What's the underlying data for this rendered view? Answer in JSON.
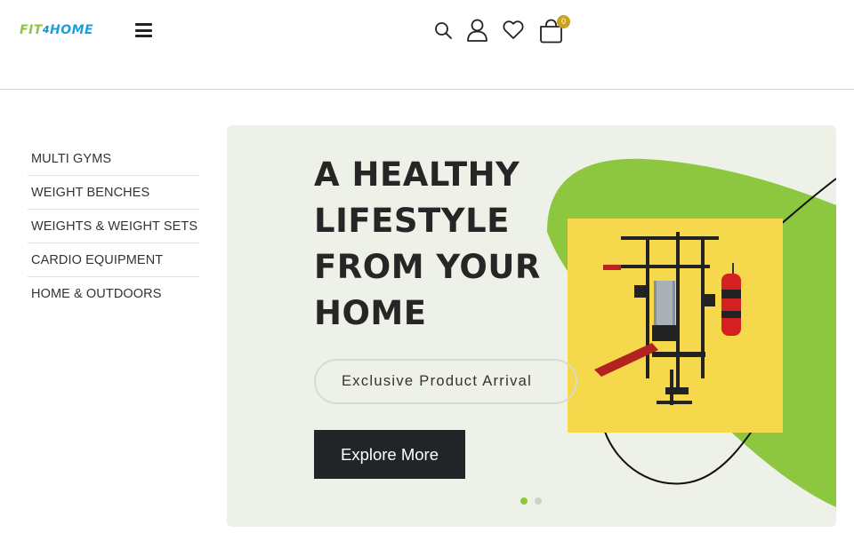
{
  "header": {
    "logo": {
      "part1": "FIT",
      "part2": "4",
      "part3": "HOME"
    },
    "cart_count": "0"
  },
  "icons": {
    "menu": "hamburger-icon",
    "search": "search-icon",
    "account": "user-icon",
    "wishlist": "heart-icon",
    "cart": "shopping-bag-icon"
  },
  "sidebar": {
    "items": [
      {
        "label": "MULTI GYMS"
      },
      {
        "label": "WEIGHT BENCHES"
      },
      {
        "label": "WEIGHTS & WEIGHT SETS"
      },
      {
        "label": "CARDIO EQUIPMENT"
      },
      {
        "label": "HOME & OUTDOORS"
      }
    ]
  },
  "hero": {
    "title": "A HEALTHY LIFESTYLE FROM YOUR HOME",
    "badge": "Exclusive Product Arrival",
    "cta": "Explore More",
    "slides_total": 2,
    "active_slide": 1
  },
  "colors": {
    "accent_green": "#8dc63f",
    "logo_blue": "#1aa1dc",
    "badge_gold": "#c8a31e",
    "hero_bg": "#edf1e7",
    "product_bg": "#f5d84c",
    "button_dark": "#222528"
  }
}
